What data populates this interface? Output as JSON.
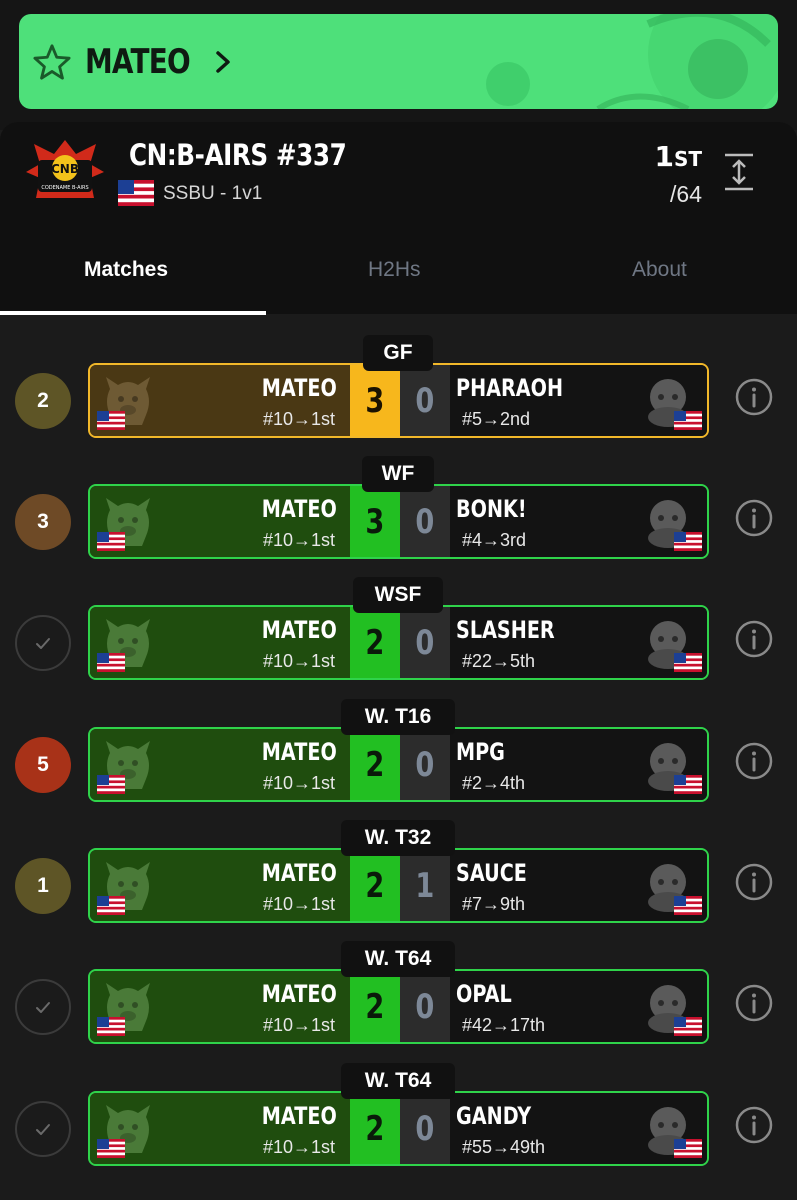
{
  "player_banner": {
    "name": "MATEO"
  },
  "tournament": {
    "name": "CN:B-AIRS #337",
    "logo_text": "CNB",
    "logo_sub": "CODENAME B-AIRS",
    "game": "SSBU - 1v1",
    "placement": "1",
    "placement_suffix": "ST",
    "entrants": "/64"
  },
  "tabs": [
    "Matches",
    "H2Hs",
    "About"
  ],
  "colors": {
    "win": "#22bf22",
    "gold": "#f7b71c",
    "banner": "#4ee07a"
  },
  "matches": [
    {
      "round": "GF",
      "badge": "2",
      "badge_color": "#5e5526",
      "left_name": "MATEO",
      "left_seed": "#10→1st",
      "score_left": "3",
      "score_right": "0",
      "right_name": "PHARAOH",
      "right_seed": "#5→2nd",
      "style": "gold",
      "right_icon": "character-icon"
    },
    {
      "round": "WF",
      "badge": "3",
      "badge_color": "#6e4a26",
      "left_name": "MATEO",
      "left_seed": "#10→1st",
      "score_left": "3",
      "score_right": "0",
      "right_name": "BONK!",
      "right_seed": "#4→3rd",
      "style": "win",
      "right_icon": "character-icon"
    },
    {
      "round": "WSF",
      "badge": "",
      "badge_color": "",
      "left_name": "MATEO",
      "left_seed": "#10→1st",
      "score_left": "2",
      "score_right": "0",
      "right_name": "SLASHER",
      "right_seed": "#22→5th",
      "style": "win",
      "right_icon": "character-icon"
    },
    {
      "round": "W. T16",
      "badge": "5",
      "badge_color": "#a83218",
      "left_name": "MATEO",
      "left_seed": "#10→1st",
      "score_left": "2",
      "score_right": "0",
      "right_name": "MPG",
      "right_seed": "#2→4th",
      "style": "win",
      "right_icon": "character-icon"
    },
    {
      "round": "W. T32",
      "badge": "1",
      "badge_color": "#5e5526",
      "left_name": "MATEO",
      "left_seed": "#10→1st",
      "score_left": "2",
      "score_right": "1",
      "right_name": "SAUCE",
      "right_seed": "#7→9th",
      "style": "win",
      "right_icon": "character-icon"
    },
    {
      "round": "W. T64",
      "badge": "",
      "badge_color": "",
      "left_name": "MATEO",
      "left_seed": "#10→1st",
      "score_left": "2",
      "score_right": "0",
      "right_name": "OPAL",
      "right_seed": "#42→17th",
      "style": "win",
      "right_icon": "character-icon"
    },
    {
      "round": "W. T64",
      "badge": "",
      "badge_color": "",
      "left_name": "MATEO",
      "left_seed": "#10→1st",
      "score_left": "2",
      "score_right": "0",
      "right_name": "GANDY",
      "right_seed": "#55→49th",
      "style": "win",
      "right_icon": "character-icon"
    }
  ]
}
